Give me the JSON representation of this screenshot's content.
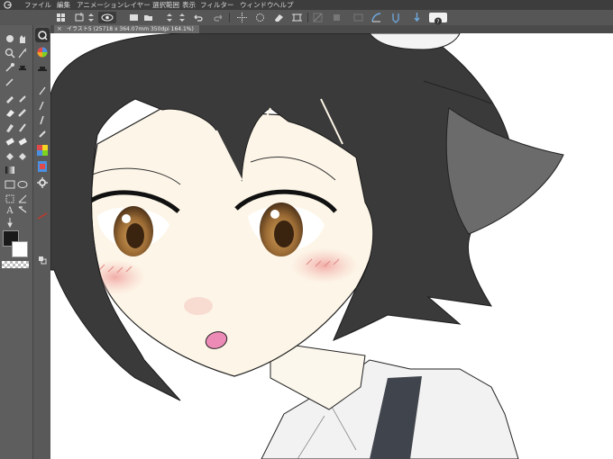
{
  "menubar": {
    "items": [
      "ファイル",
      "編集",
      "アニメーション",
      "レイヤー",
      "選択範囲",
      "表示",
      "フィルター",
      "ウィンドウ",
      "ヘルプ"
    ]
  },
  "document_tab": {
    "label": "イラスト5 (25718 x 364.07mm 350dpi 164.1%)"
  },
  "toolbar": {
    "icons": [
      "menu-grid-icon",
      "new-canvas-icon",
      "up-down-icon",
      "view-eye-icon",
      "grid-icon",
      "open-folder-icon",
      "up-down-icon",
      "save-icon",
      "up-down-icon",
      "undo-icon",
      "redo-icon",
      "move-icon",
      "transform-icon",
      "eraser-icon",
      "crop-icon",
      "ruler-icon",
      "fill-icon",
      "layer-icon",
      "curve-icon",
      "pen-icon",
      "help-icon"
    ],
    "help_glyph": "?"
  },
  "tools": {
    "icons": [
      "search-zoom-icon",
      "hand-icon",
      "magic-wand-icon",
      "lasso-icon",
      "eyedropper-icon",
      "pen-icon",
      "pencil-icon",
      "brush-icon",
      "airbrush-icon",
      "eraser-icon",
      "fill-icon",
      "gradient-icon",
      "figure-icon",
      "text-icon",
      "balloon-icon",
      "ruler-icon",
      "correction-icon"
    ],
    "text_tool_glyph": "A",
    "foreground_color": "#1a1a1a",
    "background_color": "#ffffff"
  }
}
